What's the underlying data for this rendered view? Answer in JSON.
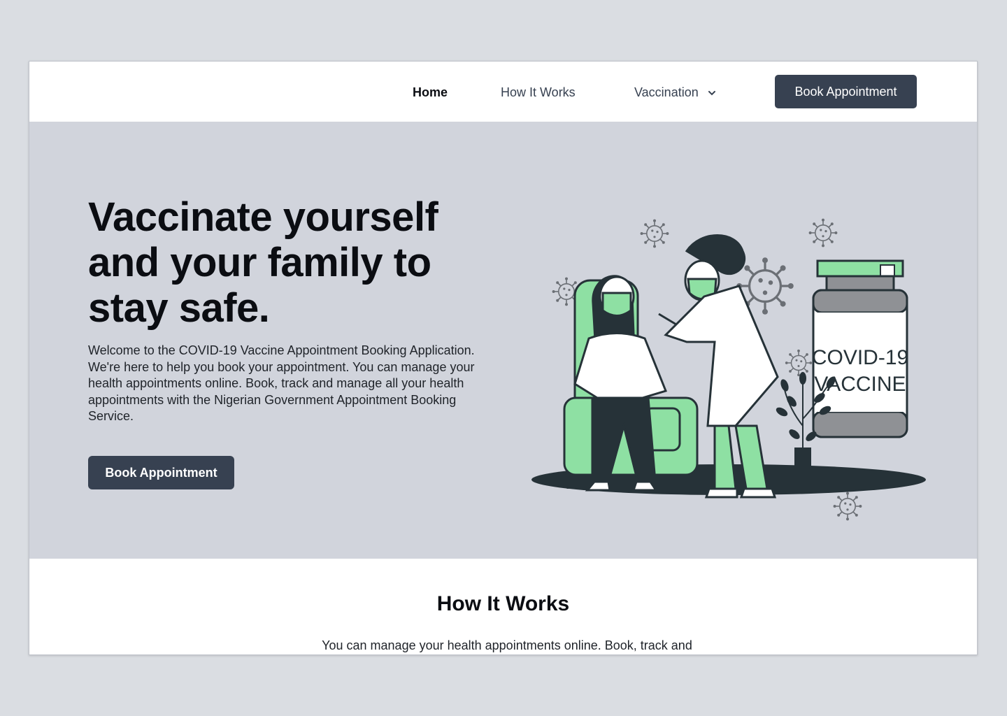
{
  "nav": {
    "home": "Home",
    "how_it_works": "How It Works",
    "vaccination": "Vaccination",
    "book_button": "Book Appointment"
  },
  "hero": {
    "title": "Vaccinate yourself and your family to stay safe.",
    "description": "Welcome to the COVID-19 Vaccine Appointment Booking Application. We're here to help you book your appointment. You can manage your health appointments online. Book, track and manage all your health appointments with the Nigerian Government Appointment Booking Service.",
    "book_button": "Book Appointment",
    "vial_line1": "COVID-19",
    "vial_line2": "VACCINE"
  },
  "how_it_works": {
    "title": "How It Works",
    "description": "You can manage your health appointments online. Book, track and manage all your health appointments by following these easy steps."
  },
  "colors": {
    "primary_button": "#374151",
    "hero_bg": "#d1d4dc",
    "accent_green": "#8ee0a3",
    "dark": "#263238"
  },
  "icons": [
    "chevron-down-icon",
    "virus-icon"
  ]
}
